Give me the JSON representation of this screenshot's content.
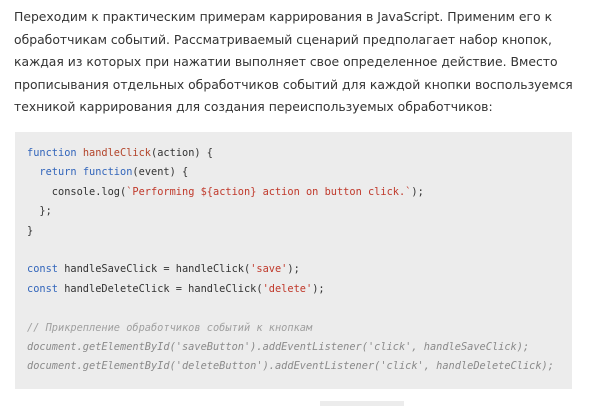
{
  "paragraph": {
    "lines": [
      "Переходим к практическим примерам каррирования в JavaScript. Применим его к",
      "обработчикам событий. Рассматриваемый сценарий предполагает набор кнопок,",
      "каждая из которых при нажатии выполняет свое определенное действие. Вместо",
      "прописывания отдельных обработчиков событий для каждой кнопки воспользуемся",
      "техникой каррирования для создания переиспользуемых обработчиков:"
    ]
  },
  "code": {
    "lines": [
      [
        {
          "t": "function",
          "c": "kw"
        },
        {
          "t": " "
        },
        {
          "t": "handleClick",
          "c": "fn"
        },
        {
          "t": "(action) {"
        }
      ],
      [
        {
          "t": "  "
        },
        {
          "t": "return",
          "c": "kw"
        },
        {
          "t": " "
        },
        {
          "t": "function",
          "c": "kw"
        },
        {
          "t": "(event) {"
        }
      ],
      [
        {
          "t": "    console.log("
        },
        {
          "t": "`Performing ${action} action on button click.`",
          "c": "str"
        },
        {
          "t": ");"
        }
      ],
      [
        {
          "t": "  };"
        }
      ],
      [
        {
          "t": "}"
        }
      ],
      [],
      [
        {
          "t": "const",
          "c": "kw"
        },
        {
          "t": " handleSaveClick = handleClick("
        },
        {
          "t": "'save'",
          "c": "str"
        },
        {
          "t": ");"
        }
      ],
      [
        {
          "t": "const",
          "c": "kw"
        },
        {
          "t": " handleDeleteClick = handleClick("
        },
        {
          "t": "'delete'",
          "c": "str"
        },
        {
          "t": ");"
        }
      ],
      [],
      [
        {
          "t": "// Прикрепление обработчиков событий к кнопкам",
          "c": "cm"
        }
      ],
      [
        {
          "t": "document.getElementById('saveButton').addEventListener('click', handleSaveClick);",
          "c": "cm-code"
        }
      ],
      [
        {
          "t": "document.getElementById('deleteButton').addEventListener('click', handleDeleteClick);",
          "c": "cm-code"
        }
      ]
    ]
  }
}
